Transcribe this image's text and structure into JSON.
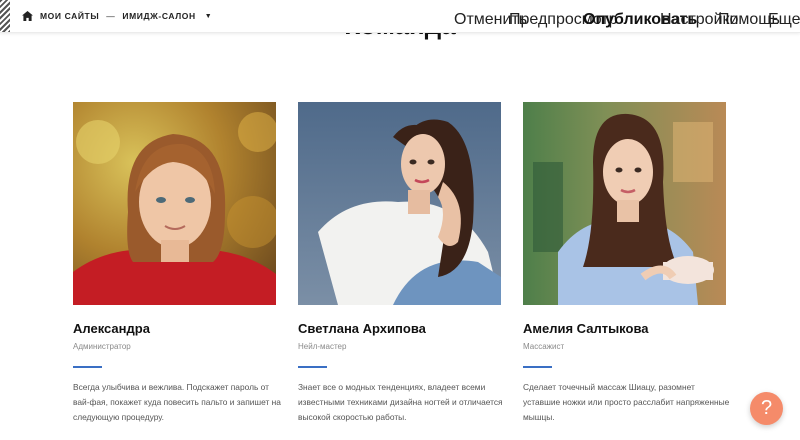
{
  "topbar": {
    "breadcrumb_root": "МОИ САЙТЫ",
    "breadcrumb_separator": "—",
    "breadcrumb_site": "ИМИДЖ-САЛОН",
    "nav": {
      "cancel": "Отменить",
      "preview": "Предпросмотр",
      "publish": "Опубликовать",
      "settings": "Настройки",
      "help": "Помощь",
      "more": "Еще"
    }
  },
  "section": {
    "title": "Команда"
  },
  "team": [
    {
      "name": "Александра",
      "role": "Администратор",
      "description": "Всегда улыбчива и вежлива. Подскажет пароль от вай-фая, покажет куда повесить пальто и запишет на следующую процедуру."
    },
    {
      "name": "Светлана Архипова",
      "role": "Нейл-мастер",
      "description": "Знает все о модных тенденциях, владеет всеми известными техниками дизайна ногтей и отличается высокой скоростью работы."
    },
    {
      "name": "Амелия Салтыкова",
      "role": "Массажист",
      "description": "Сделает точечный массаж Шиацу, разомнет уставшие ножки или просто расслабит напряженные мышцы."
    }
  ],
  "help_button": {
    "label": "?"
  },
  "colors": {
    "accent": "#3a6fc4",
    "help": "#f58b6a"
  }
}
